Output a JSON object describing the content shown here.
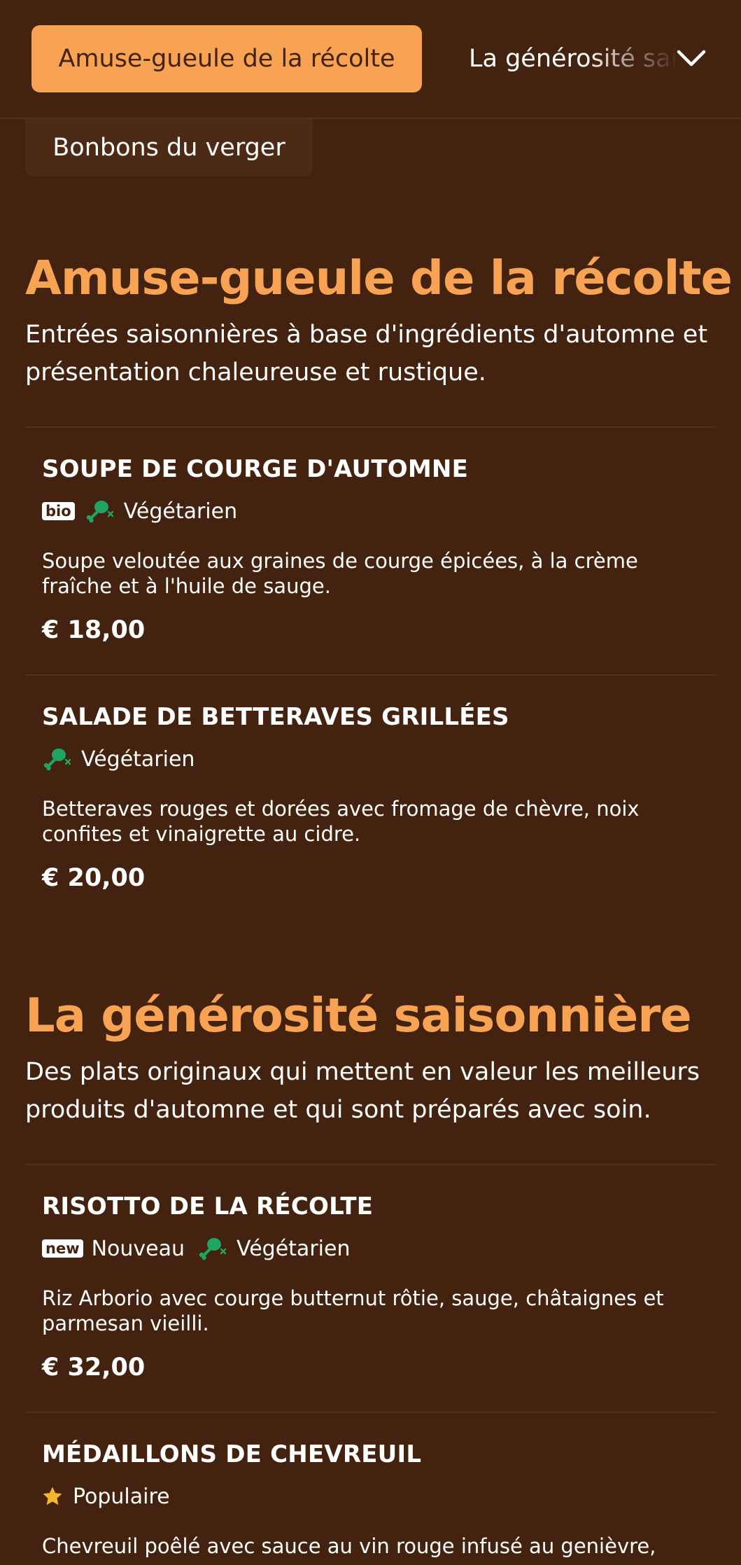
{
  "nav": {
    "active_tab": "Amuse-gueule de la récolte",
    "next_tab": "La générosité saisonnière",
    "second_row_tab": "Bonbons du verger"
  },
  "sections": [
    {
      "title": "Amuse-gueule de la récolte",
      "description": "Entrées saisonnières à base d'ingrédients d'automne et présentation chaleureuse et rustique.",
      "items": [
        {
          "name": "SOUPE DE COURGE D'AUTOMNE",
          "badge": "bio",
          "tag": "Végétarien",
          "description": "Soupe veloutée aux graines de courge épicées, à la crème fraîche et à l'huile de sauge.",
          "price": "€ 18,00"
        },
        {
          "name": "SALADE DE BETTERAVES GRILLÉES",
          "tag": "Végétarien",
          "description": "Betteraves rouges et dorées avec fromage de chèvre, noix confites et vinaigrette au cidre.",
          "price": "€ 20,00"
        }
      ]
    },
    {
      "title": "La générosité saisonnière",
      "description": "Des plats originaux qui mettent en valeur les meilleurs produits d'automne et qui sont préparés avec soin.",
      "items": [
        {
          "name": "RISOTTO DE LA RÉCOLTE",
          "badge": "new",
          "badge_label": "Nouveau",
          "tag": "Végétarien",
          "description": "Riz Arborio avec courge butternut rôtie, sauge, châtaignes et parmesan vieilli.",
          "price": "€ 32,00"
        },
        {
          "name": "MÉDAILLONS DE CHEVREUIL",
          "tag": "Populaire",
          "description": "Chevreuil poêlé avec sauce au vin rouge infusé au genièvre,"
        }
      ]
    }
  ],
  "icons": {
    "vegetarian": "meat-crossed-icon",
    "popular": "star-icon",
    "dropdown": "chevron-down-icon"
  },
  "colors": {
    "background": "#43230f",
    "accent": "#f8a253",
    "divider": "#55301a",
    "vegetarian_icon": "#1fa463",
    "star": "#f6b52a"
  }
}
